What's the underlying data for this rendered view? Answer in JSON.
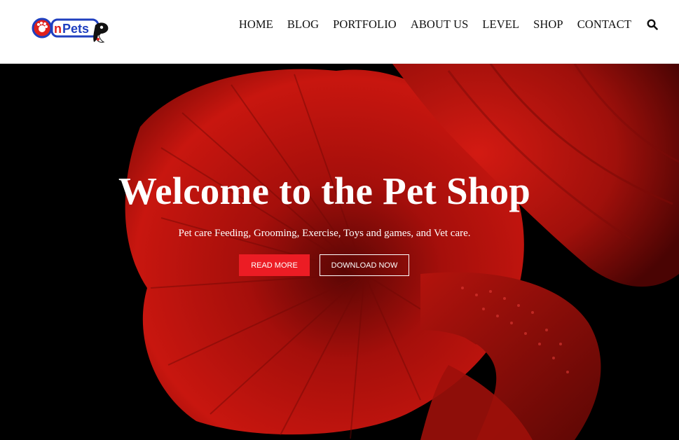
{
  "logo": {
    "text": "OnPets"
  },
  "nav": {
    "items": [
      "HOME",
      "BLOG",
      "PORTFOLIO",
      "ABOUT US",
      "LEVEL",
      "SHOP",
      "CONTACT"
    ],
    "search_icon": "search-icon"
  },
  "hero": {
    "title": "Welcome to the Pet Shop",
    "subtitle": "Pet care Feeding, Grooming, Exercise, Toys and games, and Vet care.",
    "read_more_label": "READ MORE",
    "download_label": "DOWNLOAD NOW"
  },
  "colors": {
    "accent": "#ec1c24",
    "hero_bg": "#000000",
    "fish_red": "#c0120e",
    "logo_blue": "#1f3fbf",
    "logo_red": "#e0201c"
  }
}
